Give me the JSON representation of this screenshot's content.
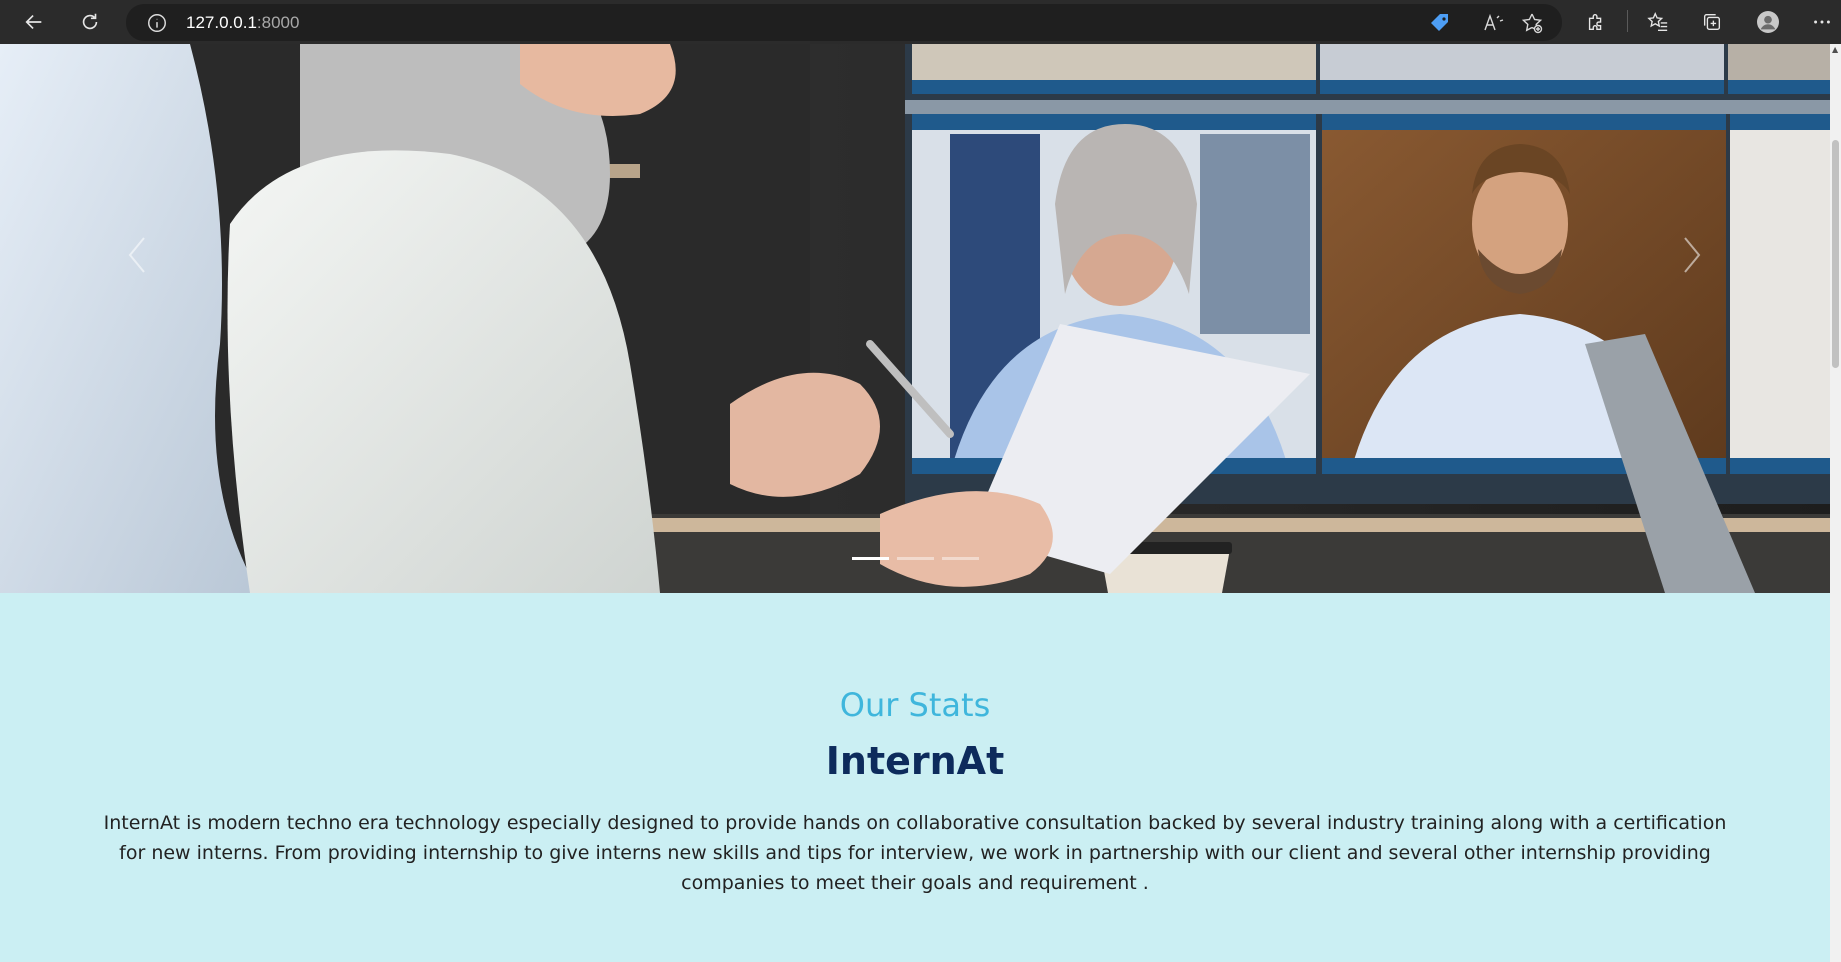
{
  "browser": {
    "url_host": "127.0.0.1",
    "url_port": ":8000",
    "icons": [
      "back-icon",
      "refresh-icon",
      "site-info-icon",
      "coupon-icon",
      "read-aloud-icon",
      "add-favorite-icon",
      "extensions-icon",
      "favorites-icon",
      "collections-icon",
      "profile-icon",
      "more-icon"
    ]
  },
  "hero": {
    "slides_count": 3,
    "active_slide": 1,
    "prev_icon": "chevron-left-icon",
    "next_icon": "chevron-right-icon"
  },
  "stats": {
    "eyebrow": "Our Stats",
    "title": "InternAt",
    "description": "InternAt is modern techno era technology especially designed to provide hands on collaborative consultation backed by several industry training along with a certification for new interns. From providing internship to give interns new skills and tips for interview, we work in partnership with our client and several other internship providing companies to meet their goals and requirement ."
  },
  "colors": {
    "chrome_bg": "#2b2b2b",
    "section_bg": "#cbeff3",
    "eyebrow": "#3fb6dc",
    "title": "#0d2b5c"
  }
}
